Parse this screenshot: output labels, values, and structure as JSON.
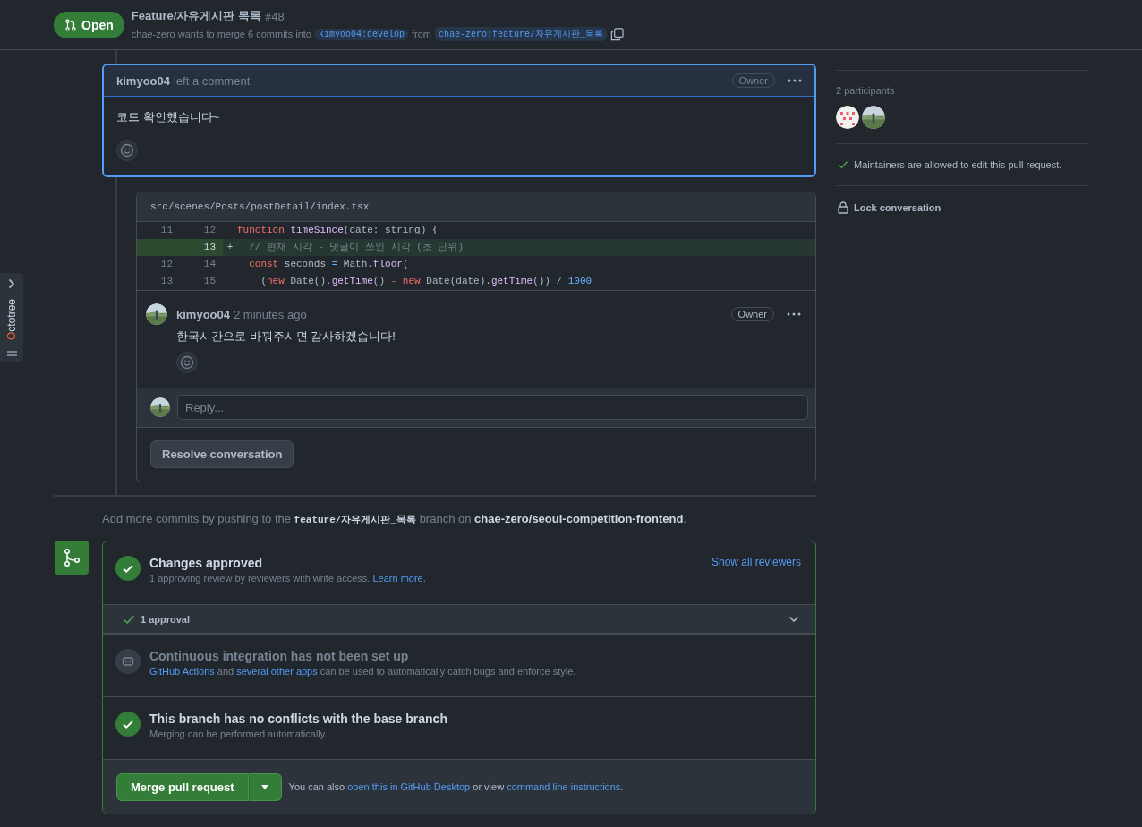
{
  "header": {
    "state": "Open",
    "title": "Feature/자유게시판 목록",
    "number": "#48",
    "summary": "chae-zero wants to merge 6 commits into",
    "base_branch": "kimyoo04:develop",
    "from_word": "from",
    "head_branch": "chae-zero:feature/자유게시판_목록"
  },
  "octotree": {
    "label": "Octotree"
  },
  "comment": {
    "author": "kimyoo04",
    "action": "left a comment",
    "role": "Owner",
    "body": "코드 확인했습니다~"
  },
  "thread": {
    "file": "src/scenes/Posts/postDetail/index.tsx",
    "lines": [
      {
        "old": "11",
        "new": "12",
        "added": false,
        "tokens": [
          {
            "kind": "keyword",
            "text": "function"
          },
          {
            "kind": "entity",
            "text": " timeSince"
          },
          {
            "kind": "plain",
            "text": "(date: string) {"
          }
        ]
      },
      {
        "new": "13",
        "added": true,
        "marker": "+",
        "tokens": [
          {
            "kind": "comment",
            "text": "  // 현재 시각 - 댓글이 쓰인 시각 (초 단위)"
          }
        ]
      },
      {
        "old": "12",
        "new": "14",
        "added": false,
        "tokens": [
          {
            "kind": "keyword",
            "text": "  const"
          },
          {
            "kind": "plain",
            "text": " seconds "
          },
          {
            "kind": "constant",
            "text": "="
          },
          {
            "kind": "plain",
            "text": " Math."
          },
          {
            "kind": "entity",
            "text": "floor"
          },
          {
            "kind": "plain",
            "text": "("
          }
        ]
      },
      {
        "old": "13",
        "new": "15",
        "added": false,
        "tokens": [
          {
            "kind": "plain",
            "text": "    ("
          },
          {
            "kind": "keyword",
            "text": "new"
          },
          {
            "kind": "plain",
            "text": " Date()."
          },
          {
            "kind": "entity",
            "text": "getTime"
          },
          {
            "kind": "plain",
            "text": "() "
          },
          {
            "kind": "keyword",
            "text": "- new"
          },
          {
            "kind": "plain",
            "text": " Date(date)."
          },
          {
            "kind": "entity",
            "text": "getTime"
          },
          {
            "kind": "plain",
            "text": "()) "
          },
          {
            "kind": "constant",
            "text": "/ 1000"
          }
        ]
      }
    ],
    "comment": {
      "author": "kimyoo04",
      "time": "2 minutes ago",
      "role": "Owner",
      "body": "한국시간으로 바꿔주시면 감사하겠습니다!"
    },
    "reply_placeholder": "Reply...",
    "resolve_button": "Resolve conversation"
  },
  "add_commits": [
    {
      "kind": "text",
      "text": "Add more commits by pushing to the "
    },
    {
      "kind": "code",
      "text": "feature/자유게시판_목록"
    },
    {
      "kind": "text",
      "text": " branch on "
    },
    {
      "kind": "strong",
      "text": "chae-zero/seoul-competition-frontend"
    },
    {
      "kind": "text",
      "text": "."
    }
  ],
  "merge": {
    "approved": {
      "title": "Changes approved",
      "description": "1 approving review by reviewers with write access.",
      "link": "Learn more.",
      "action": "Show all reviewers"
    },
    "approvals": {
      "label": "1 approval"
    },
    "checks": [
      {
        "kind": "neutral",
        "title": "Continuous integration has not been set up",
        "description": [
          {
            "kind": "link",
            "text": "GitHub Actions"
          },
          {
            "kind": "text",
            "text": " and "
          },
          {
            "kind": "link",
            "text": "several other apps"
          },
          {
            "kind": "text",
            "text": " can be used to automatically catch bugs and enforce style."
          }
        ]
      },
      {
        "kind": "success",
        "title": "This branch has no conflicts with the base branch",
        "description": [
          {
            "kind": "text",
            "text": "Merging can be performed automatically."
          }
        ]
      }
    ],
    "merge_button": "Merge pull request",
    "footer_note": [
      {
        "kind": "text",
        "text": "You can also "
      },
      {
        "kind": "link",
        "text": "open this in GitHub Desktop"
      },
      {
        "kind": "text",
        "text": " or view "
      },
      {
        "kind": "link",
        "text": "command line instructions"
      },
      {
        "kind": "text",
        "text": "."
      }
    ]
  },
  "sidebar": {
    "participants_label": "2 participants",
    "participants": [
      {
        "kind": "identicon"
      },
      {
        "kind": "picture"
      }
    ],
    "maintainers_note": "Maintainers are allowed to edit this pull request.",
    "lock": "Lock conversation"
  }
}
